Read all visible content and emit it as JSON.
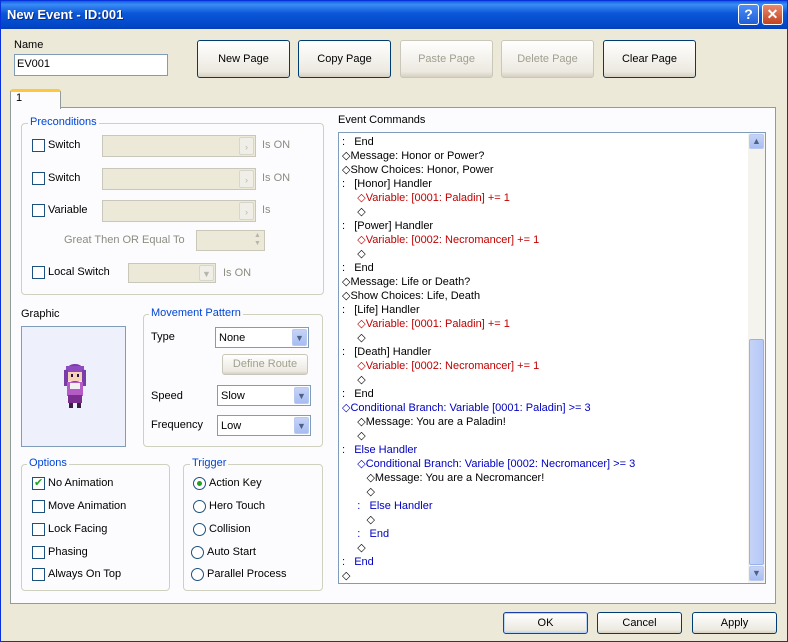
{
  "window": {
    "title": "New Event - ID:001",
    "help_glyph": "?",
    "close_glyph": "✕"
  },
  "name": {
    "label": "Name",
    "value": "EV001"
  },
  "page_buttons": {
    "new_page": "New Page",
    "copy_page": "Copy Page",
    "paste_page": "Paste Page",
    "delete_page": "Delete Page",
    "clear_page": "Clear Page"
  },
  "tabs": [
    {
      "label": "1"
    }
  ],
  "preconditions": {
    "title": "Preconditions",
    "switch1": {
      "label": "Switch",
      "suffix": "Is ON",
      "checked": false
    },
    "switch2": {
      "label": "Switch",
      "suffix": "Is ON",
      "checked": false
    },
    "variable": {
      "label": "Variable",
      "suffix": "Is",
      "checked": false
    },
    "great_then": "Great Then OR Equal To",
    "local_switch": {
      "label": "Local Switch",
      "suffix": "Is ON",
      "checked": false
    }
  },
  "graphic": {
    "label": "Graphic",
    "sprite": "purple-haired-character-sprite"
  },
  "movement": {
    "title": "Movement Pattern",
    "type_label": "Type",
    "type_value": "None",
    "define_route": "Define Route",
    "speed_label": "Speed",
    "speed_value": "Slow",
    "frequency_label": "Frequency",
    "frequency_value": "Low"
  },
  "options": {
    "title": "Options",
    "items": [
      {
        "label": "No Animation",
        "checked": true
      },
      {
        "label": "Move Animation",
        "checked": false
      },
      {
        "label": "Lock Facing",
        "checked": false
      },
      {
        "label": "Phasing",
        "checked": false
      },
      {
        "label": "Always On Top",
        "checked": false
      }
    ]
  },
  "trigger": {
    "title": "Trigger",
    "items": [
      {
        "label": "Action Key",
        "selected": true
      },
      {
        "label": "Hero Touch",
        "selected": false
      },
      {
        "label": "Collision",
        "selected": false
      },
      {
        "label": "Auto Start",
        "selected": false
      },
      {
        "label": "Parallel Process",
        "selected": false
      }
    ]
  },
  "event_commands": {
    "title": "Event Commands",
    "lines": [
      {
        "text": ":   End",
        "color": "black"
      },
      {
        "text": "◇Message: Honor or Power?",
        "color": "black"
      },
      {
        "text": "◇Show Choices: Honor, Power",
        "color": "black"
      },
      {
        "text": ":   [Honor] Handler",
        "color": "black"
      },
      {
        "text": "     ◇Variable: [0001: Paladin] += 1",
        "color": "red"
      },
      {
        "text": "     ◇",
        "color": "black"
      },
      {
        "text": ":   [Power] Handler",
        "color": "black"
      },
      {
        "text": "     ◇Variable: [0002: Necromancer] += 1",
        "color": "red"
      },
      {
        "text": "     ◇",
        "color": "black"
      },
      {
        "text": ":   End",
        "color": "black"
      },
      {
        "text": "◇Message: Life or Death?",
        "color": "black"
      },
      {
        "text": "◇Show Choices: Life, Death",
        "color": "black"
      },
      {
        "text": ":   [Life] Handler",
        "color": "black"
      },
      {
        "text": "     ◇Variable: [0001: Paladin] += 1",
        "color": "red"
      },
      {
        "text": "     ◇",
        "color": "black"
      },
      {
        "text": ":   [Death] Handler",
        "color": "black"
      },
      {
        "text": "     ◇Variable: [0002: Necromancer] += 1",
        "color": "red"
      },
      {
        "text": "     ◇",
        "color": "black"
      },
      {
        "text": ":   End",
        "color": "black"
      },
      {
        "text": "◇Conditional Branch: Variable [0001: Paladin] >= 3",
        "color": "blue"
      },
      {
        "text": "     ◇Message: You are a Paladin!",
        "color": "black"
      },
      {
        "text": "     ◇",
        "color": "black"
      },
      {
        "text": ":   Else Handler",
        "color": "blue"
      },
      {
        "text": "     ◇Conditional Branch: Variable [0002: Necromancer] >= 3",
        "color": "blue"
      },
      {
        "text": "        ◇Message: You are a Necromancer!",
        "color": "black"
      },
      {
        "text": "        ◇",
        "color": "black"
      },
      {
        "text": "     :   Else Handler",
        "color": "blue"
      },
      {
        "text": "        ◇",
        "color": "black"
      },
      {
        "text": "     :   End",
        "color": "blue"
      },
      {
        "text": "     ◇",
        "color": "black"
      },
      {
        "text": ":   End",
        "color": "blue"
      },
      {
        "text": "◇",
        "color": "black"
      }
    ]
  },
  "footer": {
    "ok": "OK",
    "cancel": "Cancel",
    "apply": "Apply"
  },
  "colors": {
    "red": "#c00000",
    "blue": "#0000c0",
    "black": "#000000",
    "accent": "#0046d5"
  }
}
